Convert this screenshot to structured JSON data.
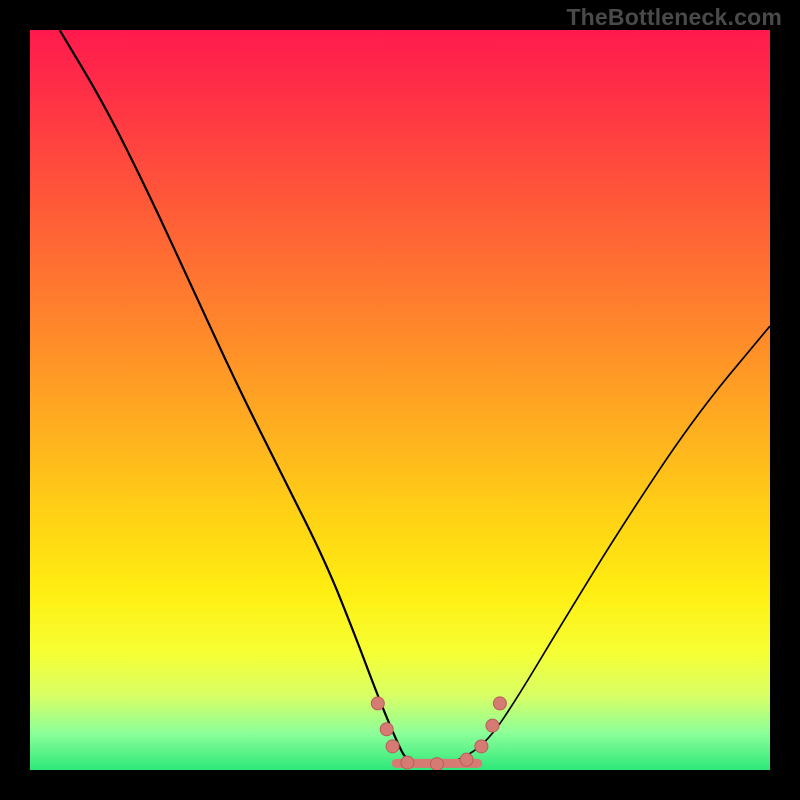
{
  "watermark": "TheBottleneck.com",
  "chart_data": {
    "type": "line",
    "title": "",
    "xlabel": "",
    "ylabel": "",
    "xlim": [
      0,
      100
    ],
    "ylim": [
      0,
      100
    ],
    "grid": false,
    "background_gradient_stops": [
      {
        "pos": 0,
        "color": "#ff1a4d"
      },
      {
        "pos": 18,
        "color": "#ff4a3d"
      },
      {
        "pos": 42,
        "color": "#ff8c29"
      },
      {
        "pos": 66,
        "color": "#ffd315"
      },
      {
        "pos": 84,
        "color": "#f6ff33"
      },
      {
        "pos": 95,
        "color": "#8cff99"
      },
      {
        "pos": 100,
        "color": "#2ee87a"
      }
    ],
    "series": [
      {
        "name": "bottleneck-curve",
        "x": [
          4,
          10,
          16,
          22,
          28,
          34,
          40,
          44,
          47,
          49.5,
          51,
          54,
          58,
          62,
          66,
          72,
          80,
          90,
          100
        ],
        "y": [
          100,
          90,
          78,
          65,
          52,
          40,
          28,
          18,
          10,
          4,
          1,
          0.6,
          1.2,
          4,
          10,
          20,
          33,
          48,
          60
        ]
      }
    ],
    "markers": [
      {
        "x": 47.0,
        "y": 9.0
      },
      {
        "x": 48.2,
        "y": 5.5
      },
      {
        "x": 49.0,
        "y": 3.2
      },
      {
        "x": 51.0,
        "y": 1.0
      },
      {
        "x": 55.0,
        "y": 0.8
      },
      {
        "x": 59.0,
        "y": 1.4
      },
      {
        "x": 61.0,
        "y": 3.2
      },
      {
        "x": 62.5,
        "y": 6.0
      },
      {
        "x": 63.5,
        "y": 9.0
      }
    ],
    "valley_band": {
      "x0": 49.5,
      "x1": 60.5,
      "y": 0.9
    }
  }
}
